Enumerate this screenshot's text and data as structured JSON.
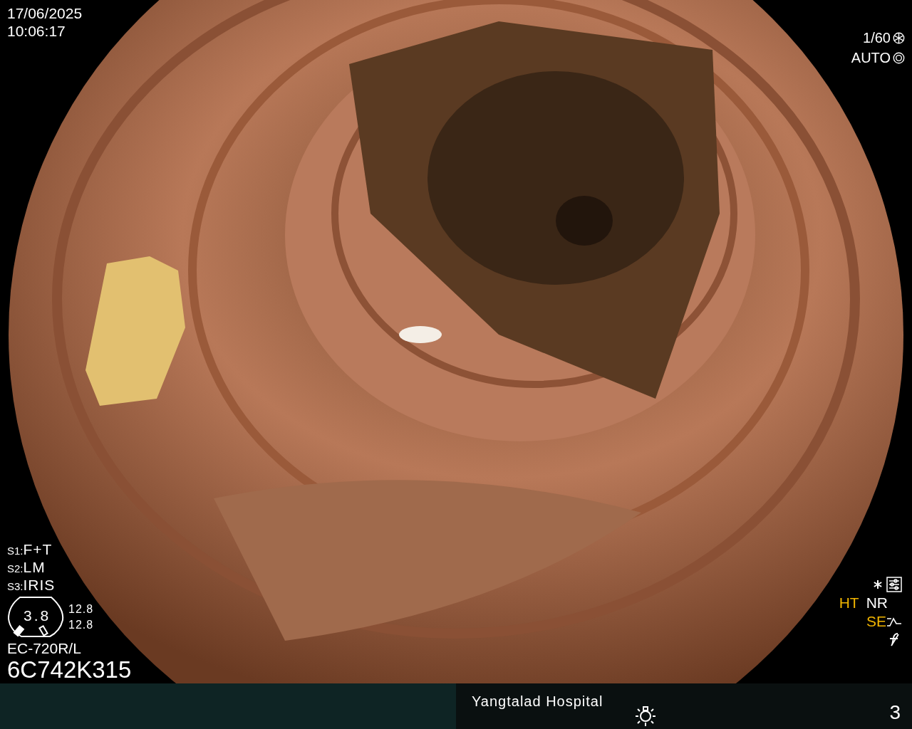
{
  "timestamp": {
    "date": "17/06/2025",
    "time": "10:06:17"
  },
  "shutter": {
    "speed": "1/60",
    "iris": "AUTO"
  },
  "switches": [
    {
      "key": "S1:",
      "value": "F+T"
    },
    {
      "key": "S2:",
      "value": "LM"
    },
    {
      "key": "S3:",
      "value": "IRIS"
    }
  ],
  "scope_gauge": {
    "center": "3.8",
    "readings": [
      "12.8",
      "12.8"
    ]
  },
  "scope_model": "EC-720R/L",
  "serial": "6C742K315",
  "indicators": [
    {
      "label": "HT",
      "color": "#f0b400"
    },
    {
      "label": "NR",
      "color": "#ffffff"
    },
    {
      "label": "SE",
      "color": "#f0b400"
    }
  ],
  "status_bar": {
    "hospital": "Yangtalad Hospital",
    "count": "3"
  }
}
